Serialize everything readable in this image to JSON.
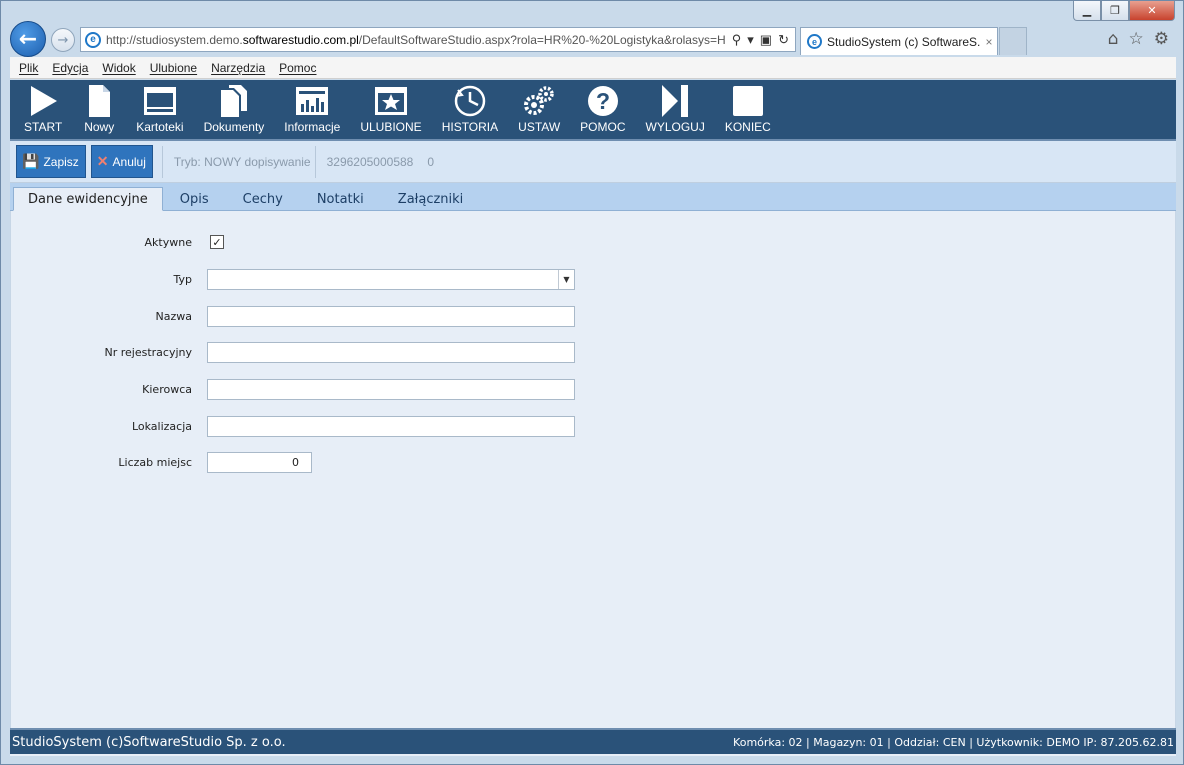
{
  "browser": {
    "url_prefix": "http://studiosystem.demo.",
    "url_domain": "softwarestudio.com.pl",
    "url_suffix": "/DefaultSoftwareStudio.aspx?rola=HR%20-%20Logistyka&rolasys=H",
    "tab_title": "StudioSystem (c) SoftwareS...",
    "tab_close": "×"
  },
  "menu": [
    "Plik",
    "Edycja",
    "Widok",
    "Ulubione",
    "Narzędzia",
    "Pomoc"
  ],
  "toolbar": {
    "start": "START",
    "nowy": "Nowy",
    "kartoteki": "Kartoteki",
    "dokumenty": "Dokumenty",
    "informacje": "Informacje",
    "ulubione": "ULUBIONE",
    "historia": "HISTORIA",
    "ustaw": "USTAW",
    "pomoc": "POMOC",
    "wyloguj": "WYLOGUJ",
    "koniec": "KONIEC"
  },
  "actions": {
    "save": "Zapisz",
    "cancel": "Anuluj",
    "mode": "Tryb: NOWY dopisywanie",
    "record_id": "3296205000588",
    "record_num": "0"
  },
  "tabs": [
    "Dane ewidencyjne",
    "Opis",
    "Cechy",
    "Notatki",
    "Załączniki"
  ],
  "form": {
    "aktywne_label": "Aktywne",
    "aktywne_checked": true,
    "typ_label": "Typ",
    "typ_value": "",
    "nazwa_label": "Nazwa",
    "nazwa_value": "",
    "nr_label": "Nr rejestracyjny",
    "nr_value": "",
    "kierowca_label": "Kierowca",
    "kierowca_value": "",
    "lokalizacja_label": "Lokalizacja",
    "lokalizacja_value": "",
    "miejsc_label": "Liczab miejsc",
    "miejsc_value": "0"
  },
  "status": {
    "left": "StudioSystem (c)SoftwareStudio Sp. z o.o.",
    "right": "Komórka: 02 | Magazyn: 01 | Oddział: CEN | Użytkownik: DEMO IP: 87.205.62.81"
  },
  "colors": {
    "toolbar_bg": "#2a5279",
    "action_button": "#2f74bd",
    "tabs_bg": "#b5d1ef",
    "form_bg": "#e7eef7"
  }
}
